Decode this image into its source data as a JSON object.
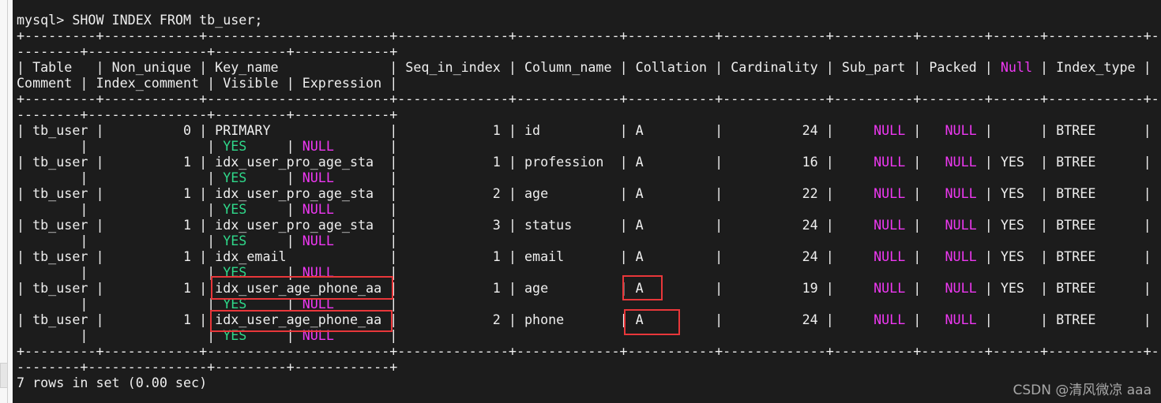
{
  "terminal": {
    "prompt": "mysql> ",
    "command": "SHOW INDEX FROM tb_user;",
    "columns": [
      "Table",
      "Non_unique",
      "Key_name",
      "Seq_in_index",
      "Column_name",
      "Collation",
      "Cardinality",
      "Sub_part",
      "Packed",
      "Null",
      "Index_type",
      "Comment",
      "Index_comment",
      "Visible",
      "Expression"
    ],
    "rows": [
      [
        "tb_user",
        "0",
        "PRIMARY",
        "1",
        "id",
        "A",
        "24",
        "NULL",
        "NULL",
        "",
        "BTREE",
        "",
        "",
        "YES",
        "NULL"
      ],
      [
        "tb_user",
        "1",
        "idx_user_pro_age_sta",
        "1",
        "profession",
        "A",
        "16",
        "NULL",
        "NULL",
        "YES",
        "BTREE",
        "",
        "",
        "YES",
        "NULL"
      ],
      [
        "tb_user",
        "1",
        "idx_user_pro_age_sta",
        "2",
        "age",
        "A",
        "22",
        "NULL",
        "NULL",
        "YES",
        "BTREE",
        "",
        "",
        "YES",
        "NULL"
      ],
      [
        "tb_user",
        "1",
        "idx_user_pro_age_sta",
        "3",
        "status",
        "A",
        "24",
        "NULL",
        "NULL",
        "YES",
        "BTREE",
        "",
        "",
        "YES",
        "NULL"
      ],
      [
        "tb_user",
        "1",
        "idx_email",
        "1",
        "email",
        "A",
        "24",
        "NULL",
        "NULL",
        "YES",
        "BTREE",
        "",
        "",
        "YES",
        "NULL"
      ],
      [
        "tb_user",
        "1",
        "idx_user_age_phone_aa",
        "1",
        "age",
        "A",
        "19",
        "NULL",
        "NULL",
        "YES",
        "BTREE",
        "",
        "",
        "YES",
        "NULL"
      ],
      [
        "tb_user",
        "1",
        "idx_user_age_phone_aa",
        "2",
        "phone",
        "A",
        "24",
        "NULL",
        "NULL",
        "",
        "BTREE",
        "",
        "",
        "YES",
        "NULL"
      ]
    ],
    "footer": "7 rows in set (0.00 sec)"
  },
  "colors": {
    "background": "#1c1c1c",
    "null_keyword": "#ee38f2",
    "yes_keyword": "#2fd88a",
    "highlight_box": "#e8373a"
  },
  "watermark": "CSDN @清风微凉 aaa"
}
